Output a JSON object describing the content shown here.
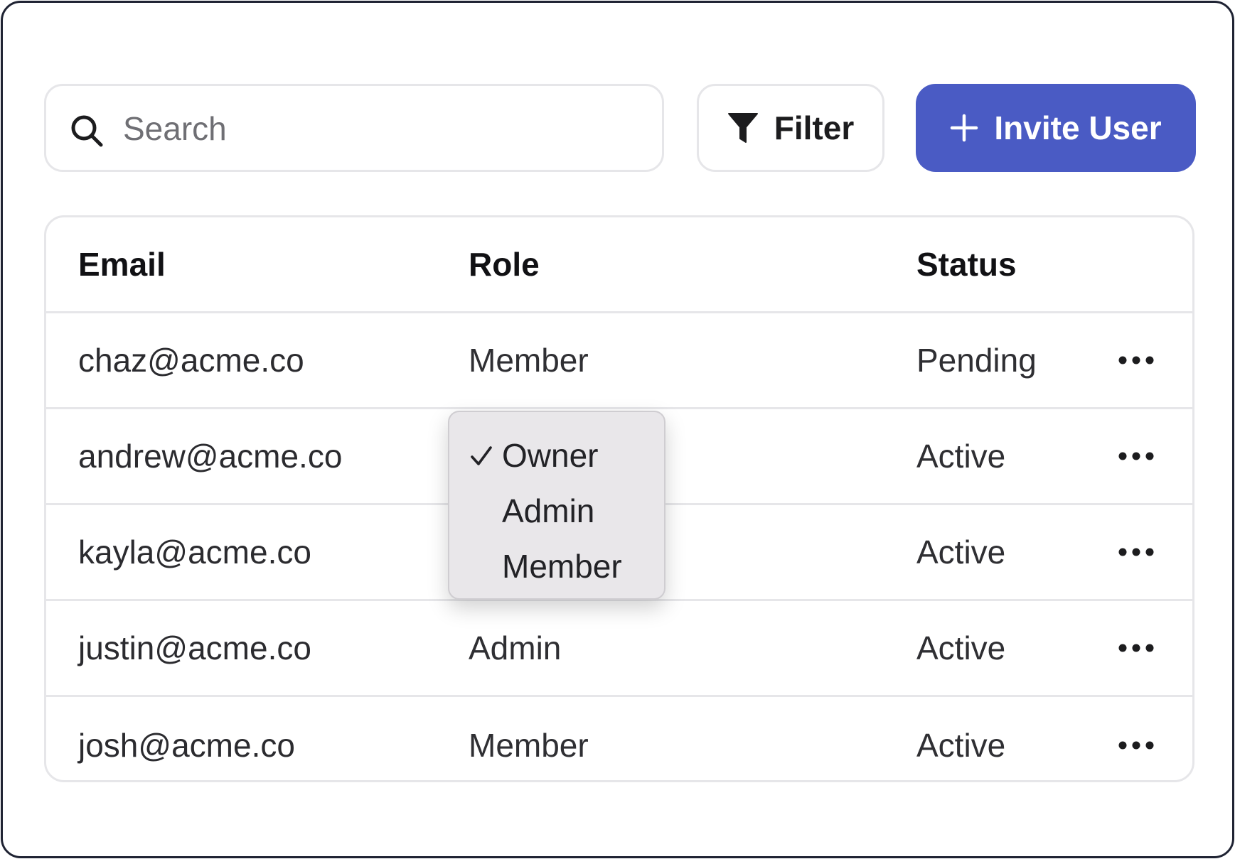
{
  "toolbar": {
    "search_placeholder": "Search",
    "search_value": "",
    "filter_label": "Filter",
    "invite_label": "Invite User"
  },
  "table": {
    "headers": {
      "email": "Email",
      "role": "Role",
      "status": "Status"
    },
    "rows": [
      {
        "email": "chaz@acme.co",
        "role": "Member",
        "status": "Pending"
      },
      {
        "email": "andrew@acme.co",
        "role": "",
        "status": "Active"
      },
      {
        "email": "kayla@acme.co",
        "role": "",
        "status": "Active"
      },
      {
        "email": "justin@acme.co",
        "role": "Admin",
        "status": "Active"
      },
      {
        "email": "josh@acme.co",
        "role": "Member",
        "status": "Active"
      }
    ]
  },
  "role_dropdown": {
    "selected": "Owner",
    "options": [
      "Owner",
      "Admin",
      "Member"
    ]
  },
  "colors": {
    "accent": "#4a5bc4",
    "border": "#e6e6e9",
    "dropdown_bg": "#e9e7ea"
  },
  "icons": {
    "search": "search-icon",
    "filter": "filter-icon",
    "invite": "plus-icon",
    "row_actions": "more-horizontal-icon",
    "selected_option": "check-icon"
  }
}
